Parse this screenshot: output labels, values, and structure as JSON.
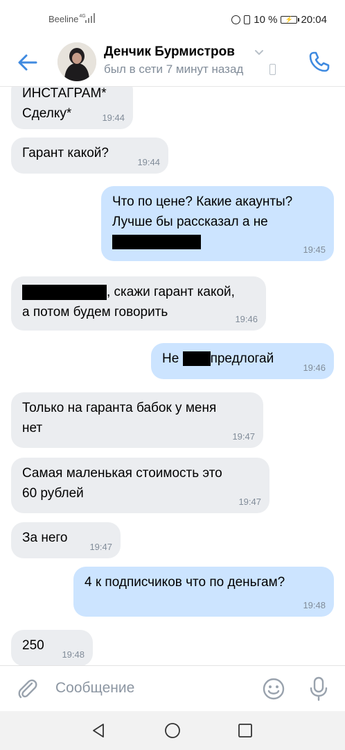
{
  "status_bar": {
    "carrier": "Beeline",
    "network": "4G",
    "battery": "10 %",
    "time": "20:04"
  },
  "header": {
    "name": "Денчик Бурмистров",
    "last_seen": "был в сети 7 минут назад"
  },
  "messages": [
    {
      "id": "m1",
      "direction": "incoming",
      "time": "19:44",
      "lines": [
        "ИНСТАГРАМ*",
        "Сделку*"
      ]
    },
    {
      "id": "m2",
      "direction": "incoming",
      "time": "19:44",
      "lines": [
        "Гарант какой?"
      ]
    },
    {
      "id": "m3",
      "direction": "outgoing",
      "time": "19:45",
      "lines": [
        "Что по цене? Какие акаунты?",
        "Лучше бы рассказал а не"
      ]
    },
    {
      "id": "m4",
      "direction": "incoming",
      "time": "19:46",
      "text_after_redaction": ", скажи гарант какой,",
      "line2": "а потом будем говорить"
    },
    {
      "id": "m5",
      "direction": "outgoing",
      "time": "19:46",
      "text_before_redaction": "Не",
      "text_after_redaction": "предлогай"
    },
    {
      "id": "m6",
      "direction": "incoming",
      "time": "19:47",
      "lines": [
        "Только на гаранта бабок у меня",
        "нет"
      ]
    },
    {
      "id": "m7",
      "direction": "incoming",
      "time": "19:47",
      "lines": [
        "Самая маленькая стоимость это",
        "60 рублей"
      ]
    },
    {
      "id": "m8",
      "direction": "incoming",
      "time": "19:47",
      "lines": [
        "За него"
      ]
    },
    {
      "id": "m9",
      "direction": "outgoing",
      "time": "19:48",
      "lines": [
        "4 к подписчиков что по деньгам?"
      ]
    },
    {
      "id": "m10",
      "direction": "incoming",
      "time": "19:48",
      "lines": [
        "250"
      ]
    }
  ],
  "composer": {
    "placeholder": "Сообщение"
  },
  "icons": {
    "back": "arrow-left-icon",
    "dropdown": "chevron-down-icon",
    "call": "phone-icon",
    "attach": "paperclip-icon",
    "emoji": "smile-icon",
    "mic": "microphone-icon"
  },
  "colors": {
    "accent": "#2a5885",
    "link_blue": "#3f8ae0",
    "incoming_bubble": "#ebedf0",
    "outgoing_bubble": "#cce4ff",
    "meta_gray": "#818c99"
  }
}
